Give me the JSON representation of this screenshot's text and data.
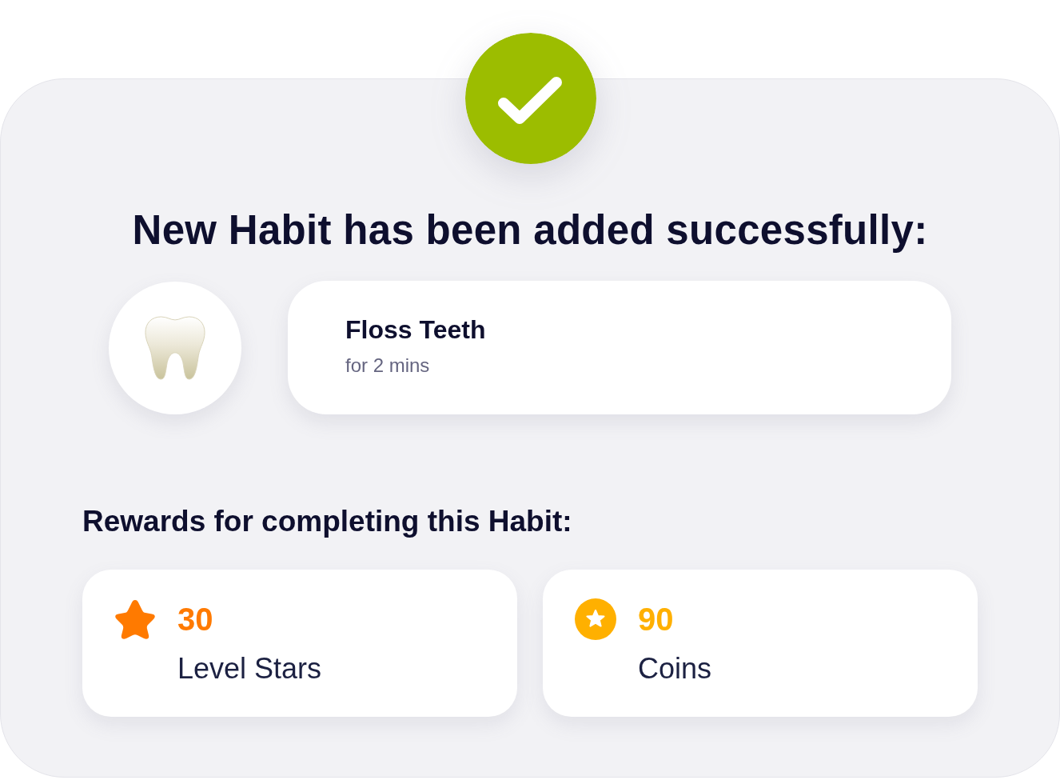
{
  "title": "New Habit has been added successfully:",
  "habit": {
    "name": "Floss Teeth",
    "duration": "for 2 mins"
  },
  "rewards_heading": "Rewards for completing this Habit:",
  "rewards": [
    {
      "kind": "stars",
      "value": "30",
      "label": "Level Stars",
      "color": "#ff7a00"
    },
    {
      "kind": "coins",
      "value": "90",
      "label": "Coins",
      "color": "#ffb000"
    }
  ]
}
